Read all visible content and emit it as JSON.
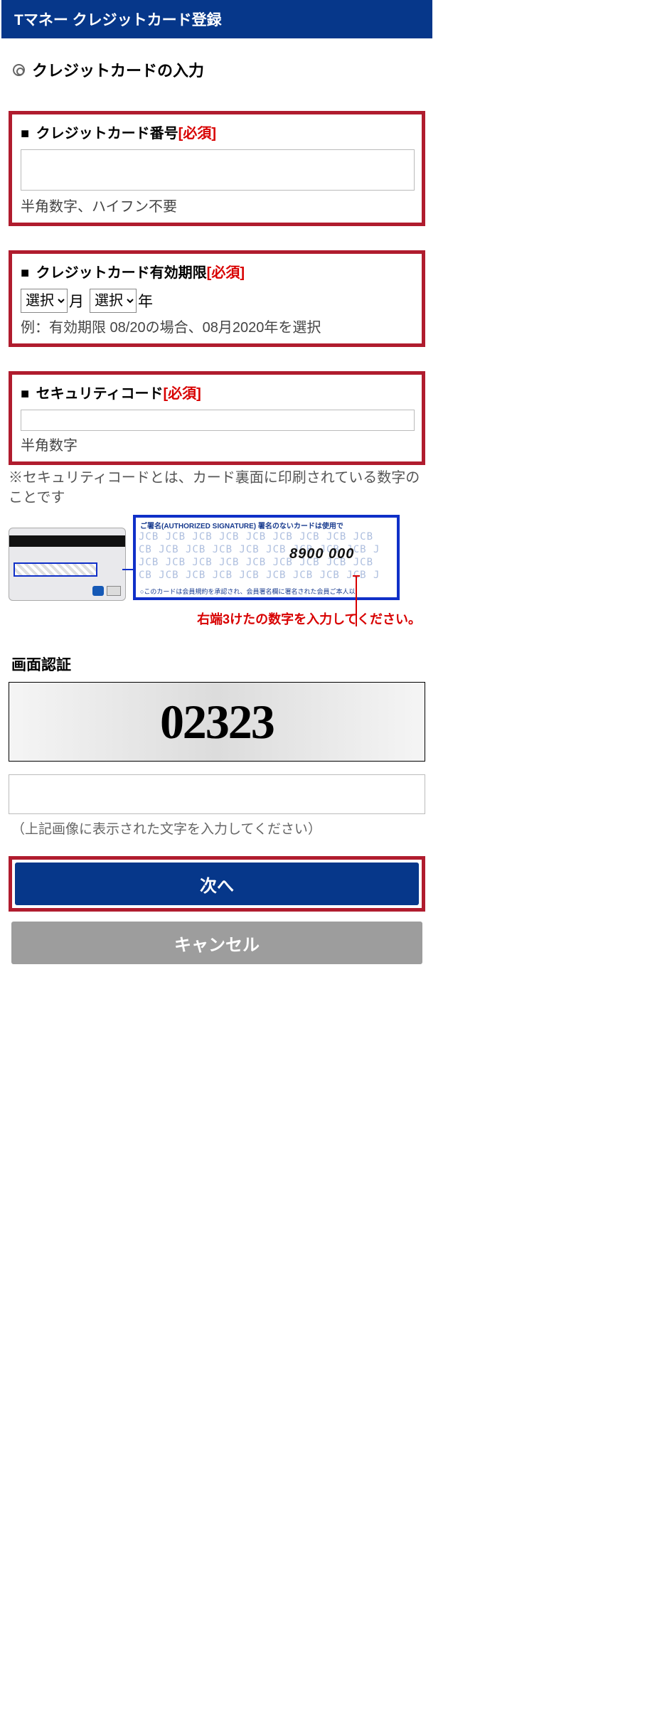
{
  "header": {
    "title": "Tマネー クレジットカード登録"
  },
  "section": {
    "title": "クレジットカードの入力"
  },
  "required_tag": "[必須]",
  "bullet": "■",
  "card_number": {
    "label": "クレジットカード番号",
    "value": "",
    "helper": "半角数字、ハイフン不要"
  },
  "expiry": {
    "label": "クレジットカード有効期限",
    "month_placeholder": "選択",
    "month_suffix": "月",
    "year_placeholder": "選択",
    "year_suffix": "年",
    "helper": "例：有効期限 08/20の場合、08月2020年を選択"
  },
  "cvv": {
    "label": "セキュリティコード",
    "value": "",
    "helper": "半角数字",
    "explain": "※セキュリティコードとは、カード裏面に印刷されている数字のことです",
    "zoom_header": "ご署名(AUTHORIZED SIGNATURE) 署名のないカードは使用で",
    "zoom_digits": "8900 000",
    "zoom_footer": "○このカードは会員規約を承認され、会員署名欄に署名された会員ご本人以",
    "red_note": "右端3けたの数字を入力してください。"
  },
  "captcha": {
    "title": "画面認証",
    "image_text": "02323",
    "input_value": "",
    "helper": "（上記画像に表示された文字を入力してください）"
  },
  "buttons": {
    "next": "次へ",
    "cancel": "キャンセル"
  }
}
